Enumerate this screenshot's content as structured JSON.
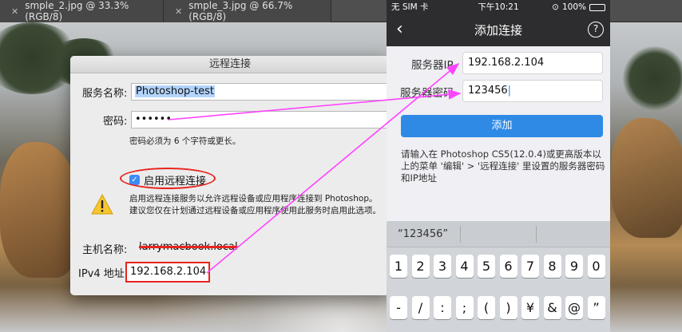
{
  "photoshop": {
    "tabs": [
      {
        "label": "smple_2.jpg @ 33.3%(RGB/8)"
      },
      {
        "label": "smple_3.jpg @ 66.7%(RGB/8)"
      }
    ]
  },
  "dialog": {
    "title": "远程连接",
    "service_name_label": "服务名称:",
    "service_name_value": "Photoshop-test",
    "password_label": "密码:",
    "password_value": "••••••",
    "password_hint": "密码必须为 6 个字符或更长。",
    "enable_label": "启用远程连接",
    "enable_checked": true,
    "warning_line1": "启用远程连接服务以允许远程设备或应用程序连接到 Photoshop。",
    "warning_line2": "建议您仅在计划通过远程设备或应用程序使用此服务时启用此选项。",
    "hostname_label": "主机名称:",
    "hostname_value": "larrymacbook.local",
    "ipv4_label": "IPv4 地址:",
    "ipv4_value": "192.168.2.104"
  },
  "phone": {
    "status": {
      "carrier": "无 SIM 卡",
      "time": "下午10:21",
      "battery": "100%"
    },
    "nav": {
      "title": "添加连接",
      "back_icon": "chevron-left-icon",
      "help": "?"
    },
    "server_ip_label": "服务器IP",
    "server_ip_value": "192.168.2.104",
    "server_password_label": "服务器密码",
    "server_password_value": "123456",
    "add_button": "添加",
    "instructions": "请输入在 Photoshop CS5(12.0.4)或更高版本以上的菜单 '编辑' > '远程连接' 里设置的服务器密码和IP地址",
    "keyboard": {
      "prediction": "“123456”",
      "row1": [
        "1",
        "2",
        "3",
        "4",
        "5",
        "6",
        "7",
        "8",
        "9",
        "0"
      ],
      "row2": [
        "-",
        "/",
        ":",
        ";",
        "(",
        ")",
        "¥",
        "&",
        "@",
        "”"
      ]
    }
  },
  "colors": {
    "annotation_arrow": "#ff44ff",
    "highlight_red": "#e8241e",
    "ios_blue": "#2f8ae6"
  }
}
